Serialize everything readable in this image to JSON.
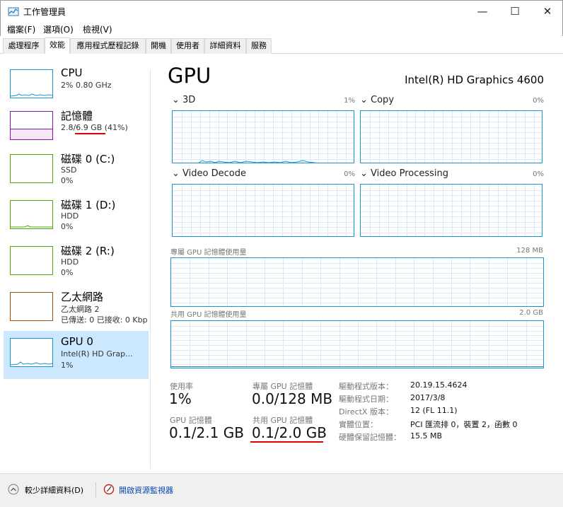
{
  "window": {
    "title": "工作管理員",
    "minimize": "—",
    "maximize": "☐",
    "close": "✕"
  },
  "menu": [
    "檔案(F)",
    "選項(O)",
    "檢視(V)"
  ],
  "tabs": [
    "處理程序",
    "效能",
    "應用程式歷程記錄",
    "開機",
    "使用者",
    "詳細資料",
    "服務"
  ],
  "active_tab": "效能",
  "sidebar": [
    {
      "title": "CPU",
      "sub1": "2%  0.80 GHz",
      "sub2": "",
      "color": "#1793d1"
    },
    {
      "title": "記憶體",
      "sub1": "2.8/6.9 GB (41%)",
      "sub2": "",
      "color": "#8b12ae"
    },
    {
      "title": "磁碟 0 (C:)",
      "sub1": "SSD",
      "sub2": "0%",
      "color": "#4da60c"
    },
    {
      "title": "磁碟 1 (D:)",
      "sub1": "HDD",
      "sub2": "0%",
      "color": "#4da60c"
    },
    {
      "title": "磁碟 2 (R:)",
      "sub1": "HDD",
      "sub2": "0%",
      "color": "#4da60c"
    },
    {
      "title": "乙太網路",
      "sub1": "乙太網路 2",
      "sub2": "已傳送: 0 已接收: 0 Kbp",
      "color": "#a74f01"
    },
    {
      "title": "GPU 0",
      "sub1": "Intel(R) HD Grap...",
      "sub2": "1%",
      "color": "#1793d1"
    }
  ],
  "main": {
    "heading": "GPU",
    "gpu_name": "Intel(R) HD Graphics 4600",
    "engines": [
      {
        "label": "3D",
        "pct": "1%"
      },
      {
        "label": "Copy",
        "pct": "0%"
      },
      {
        "label": "Video Decode",
        "pct": "0%"
      },
      {
        "label": "Video Processing",
        "pct": "0%"
      }
    ],
    "dedicated_label": "專屬 GPU 記憶體使用量",
    "dedicated_max": "128 MB",
    "shared_label": "共用 GPU 記憶體使用量",
    "shared_max": "2.0 GB",
    "stats": {
      "util_label": "使用率",
      "util_value": "1%",
      "gpu_mem_label": "GPU 記憶體",
      "gpu_mem_value": "0.1/2.1 GB",
      "ded_label": "專屬 GPU 記憶體",
      "ded_value": "0.0/128 MB",
      "shr_label": "共用 GPU 記憶體",
      "shr_value": "0.1/2.0 GB"
    },
    "info": [
      {
        "k": "驅動程式版本：",
        "v": "20.19.15.4624"
      },
      {
        "k": "驅動程式日期：",
        "v": "2017/3/8"
      },
      {
        "k": "DirectX 版本：",
        "v": "12 (FL 11.1)"
      },
      {
        "k": "實體位置：",
        "v": "PCI 匯流排 0，裝置 2，函數 0"
      },
      {
        "k": "硬體保留記憶體：",
        "v": "15.5 MB"
      }
    ]
  },
  "bottom": {
    "fewer_details": "較少詳細資料(D)",
    "resource_monitor": "開啟資源監視器"
  },
  "colors": {
    "accent": "#1793d1",
    "highlight": "#cce8ff",
    "annotation": "#e00000"
  }
}
